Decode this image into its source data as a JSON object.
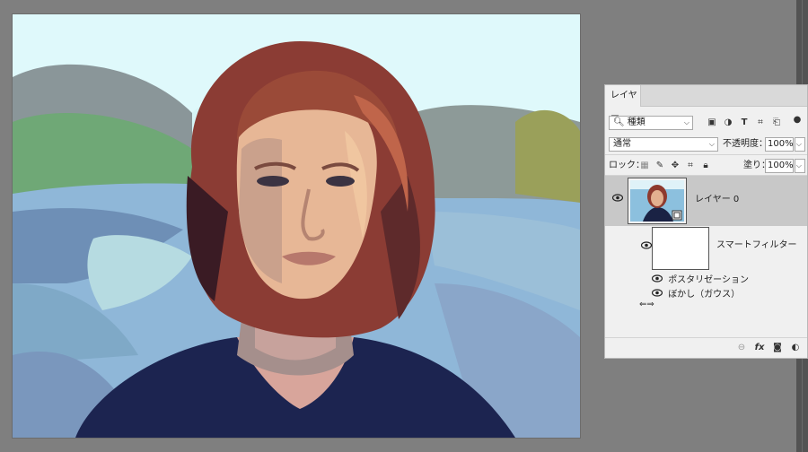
{
  "panel": {
    "tab_label": "レイヤー",
    "filter_kind": "種類",
    "blend_mode": "通常",
    "opacity_label": "不透明度：",
    "opacity_value": "100%",
    "lock_label": "ロック：",
    "fill_label": "塗り：",
    "fill_value": "100%"
  },
  "layers": {
    "main_name": "レイヤー 0",
    "smart_filter_label": "スマートフィルター",
    "filters": [
      "ポスタリゼーション",
      "ぼかし（ガウス）"
    ]
  },
  "icons": {
    "filter_bar": [
      "search-icon",
      "image-filter-icon",
      "adjustment-filter-icon",
      "type-filter-icon",
      "shape-filter-icon",
      "smart-object-filter-icon",
      "filter-toggle-icon"
    ],
    "lock": [
      "lock-transparent-icon",
      "lock-image-icon",
      "lock-position-icon",
      "lock-artboard-icon",
      "lock-all-icon"
    ],
    "bottom": [
      "link-layers-icon",
      "fx-icon",
      "add-mask-icon",
      "new-adjustment-icon"
    ]
  }
}
